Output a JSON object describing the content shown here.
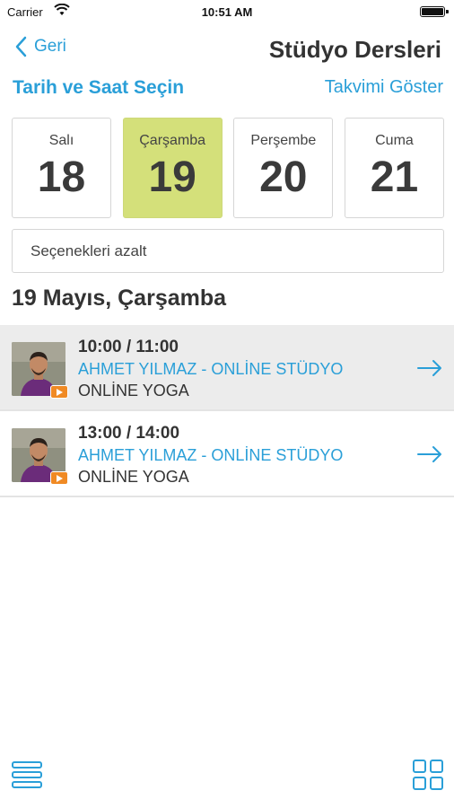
{
  "status": {
    "carrier": "Carrier",
    "time": "10:51 AM"
  },
  "nav": {
    "back_label": "Geri",
    "title": "Stüdyo Dersleri"
  },
  "subheader": {
    "left": "Tarih ve Saat Seçin",
    "right": "Takvimi Göster"
  },
  "days": [
    {
      "name": "Salı",
      "num": "18",
      "selected": false
    },
    {
      "name": "Çarşamba",
      "num": "19",
      "selected": true
    },
    {
      "name": "Perşembe",
      "num": "20",
      "selected": false
    },
    {
      "name": "Cuma",
      "num": "21",
      "selected": false
    }
  ],
  "filter_label": "Seçenekleri azalt",
  "date_heading": "19 Mayıs, Çarşamba",
  "classes": [
    {
      "time": "10:00 / 11:00",
      "instructor": "AHMET YILMAZ - ONLİNE STÜDYO",
      "type": "ONLİNE YOGA",
      "highlighted": true
    },
    {
      "time": "13:00 / 14:00",
      "instructor": "AHMET YILMAZ - ONLİNE STÜDYO",
      "type": "ONLİNE YOGA",
      "highlighted": false
    }
  ],
  "colors": {
    "accent": "#2a9fd8",
    "selected_day": "#d4e07a",
    "badge": "#f08a24"
  },
  "icons": {
    "back": "chevron-left-icon",
    "row_arrow": "arrow-right-icon",
    "list_view": "list-icon",
    "grid_view": "grid-icon",
    "video": "play-icon"
  }
}
